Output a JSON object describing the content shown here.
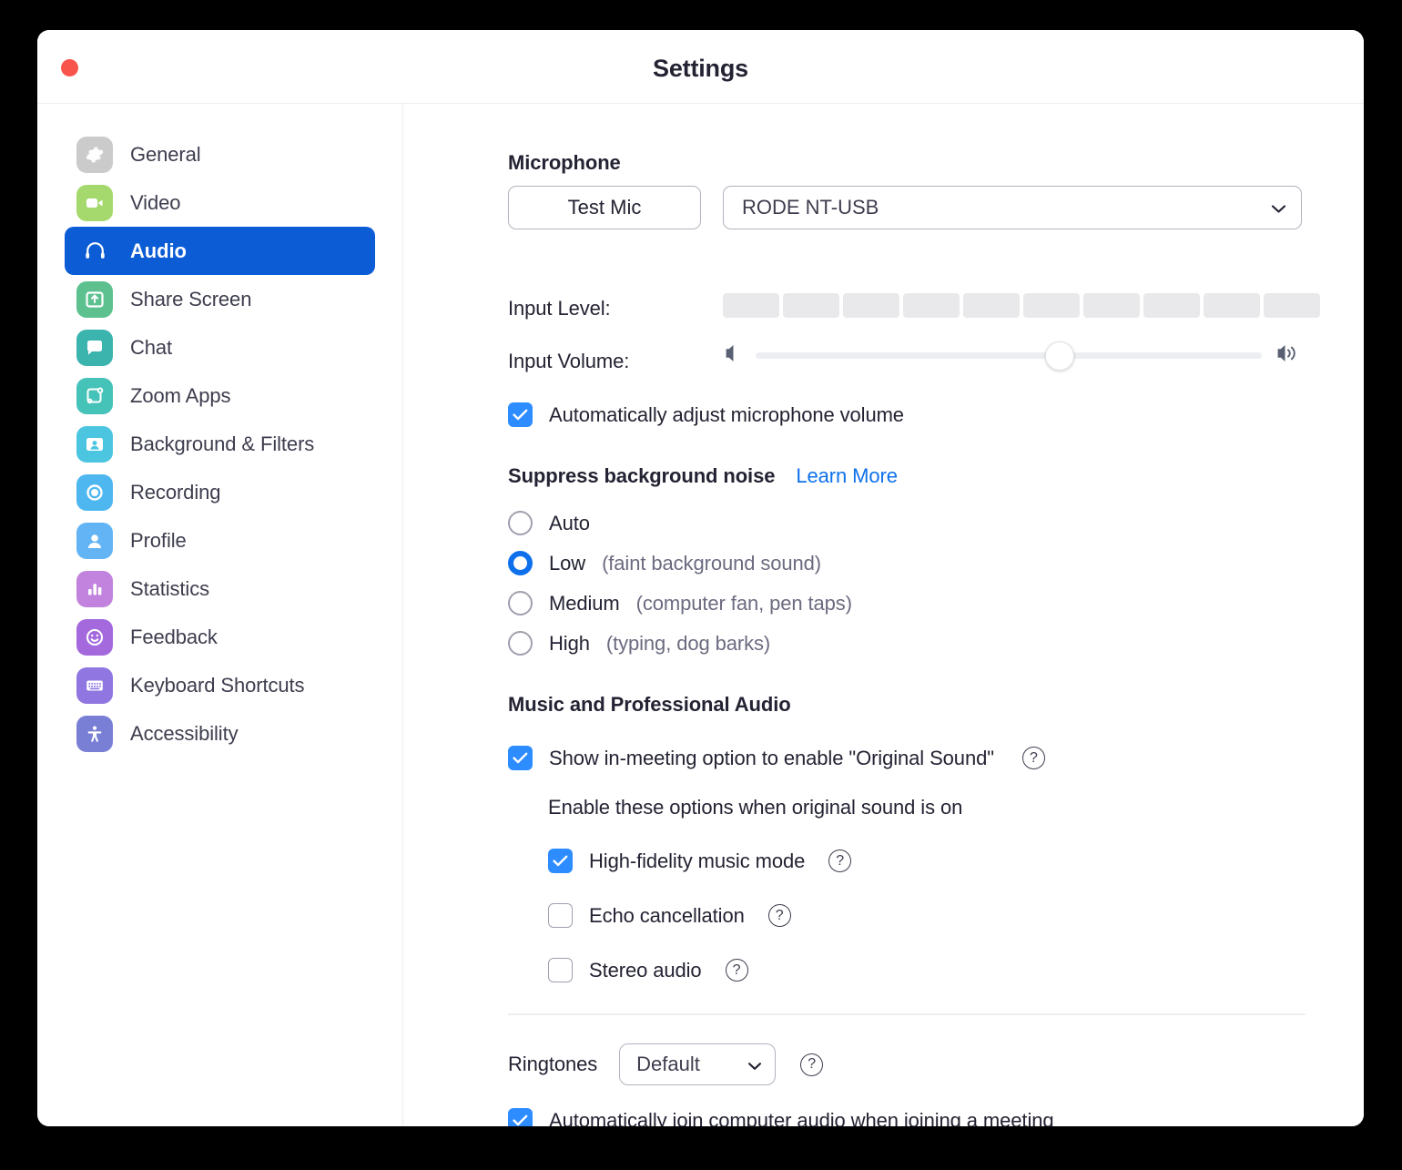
{
  "window": {
    "title": "Settings",
    "close_button": "close",
    "accent_blue": "#0e71eb",
    "active_nav_blue": "#0b5cd5",
    "checkbox_blue": "#2d8cff",
    "close_red": "#f9544b"
  },
  "sidebar": {
    "items": [
      {
        "label": "General",
        "icon": "gear-icon",
        "color": "#cbcbcb",
        "active": false
      },
      {
        "label": "Video",
        "icon": "video-camera-icon",
        "color": "#a6d96d",
        "active": false
      },
      {
        "label": "Audio",
        "icon": "headset-icon",
        "color": "#0b5cd5",
        "active": true
      },
      {
        "label": "Share Screen",
        "icon": "share-screen-icon",
        "color": "#5cc08f",
        "active": false
      },
      {
        "label": "Chat",
        "icon": "chat-bubble-icon",
        "color": "#3cb4ae",
        "active": false
      },
      {
        "label": "Zoom Apps",
        "icon": "zoom-apps-icon",
        "color": "#45c3b8",
        "active": false
      },
      {
        "label": "Background & Filters",
        "icon": "background-filters-icon",
        "color": "#4cc6e0",
        "active": false
      },
      {
        "label": "Recording",
        "icon": "record-circle-icon",
        "color": "#4fb7f0",
        "active": false
      },
      {
        "label": "Profile",
        "icon": "person-icon",
        "color": "#62b4f5",
        "active": false
      },
      {
        "label": "Statistics",
        "icon": "bar-chart-icon",
        "color": "#c183dd",
        "active": false
      },
      {
        "label": "Feedback",
        "icon": "smiley-face-icon",
        "color": "#a469dd",
        "active": false
      },
      {
        "label": "Keyboard Shortcuts",
        "icon": "keyboard-icon",
        "color": "#8f76e0",
        "active": false
      },
      {
        "label": "Accessibility",
        "icon": "accessibility-icon",
        "color": "#7a7fd6",
        "active": false
      }
    ]
  },
  "main": {
    "microphone": {
      "heading": "Microphone",
      "test_mic_label": "Test Mic",
      "device_value": "RODE NT-USB",
      "input_level_label": "Input Level:",
      "input_level_segments": 10,
      "input_level_filled": 0,
      "input_volume_label": "Input Volume:",
      "input_volume_percent": 60,
      "volume_low_icon": "speaker-low-icon",
      "volume_high_icon": "speaker-high-icon",
      "auto_adjust_label": "Automatically adjust microphone volume",
      "auto_adjust_checked": true
    },
    "suppress_noise": {
      "heading": "Suppress background noise",
      "learn_more_label": "Learn More",
      "selected": "Low",
      "options": [
        {
          "label": "Auto",
          "hint": "",
          "selected": false
        },
        {
          "label": "Low",
          "hint": "(faint background sound)",
          "selected": true
        },
        {
          "label": "Medium",
          "hint": "(computer fan, pen taps)",
          "selected": false
        },
        {
          "label": "High",
          "hint": "(typing, dog barks)",
          "selected": false
        }
      ]
    },
    "music_audio": {
      "heading": "Music and Professional Audio",
      "original_sound_label": "Show in-meeting option to enable \"Original Sound\"",
      "original_sound_checked": true,
      "original_sound_help": "?",
      "sub_note": "Enable these options when original sound is on",
      "sub_options": [
        {
          "label": "High-fidelity music mode",
          "checked": true,
          "help": "?"
        },
        {
          "label": "Echo cancellation",
          "checked": false,
          "help": "?"
        },
        {
          "label": "Stereo audio",
          "checked": false,
          "help": "?"
        }
      ]
    },
    "ringtones": {
      "label": "Ringtones",
      "value": "Default",
      "help": "?"
    },
    "auto_join": {
      "label": "Automatically join computer audio when joining a meeting",
      "checked": true
    }
  }
}
